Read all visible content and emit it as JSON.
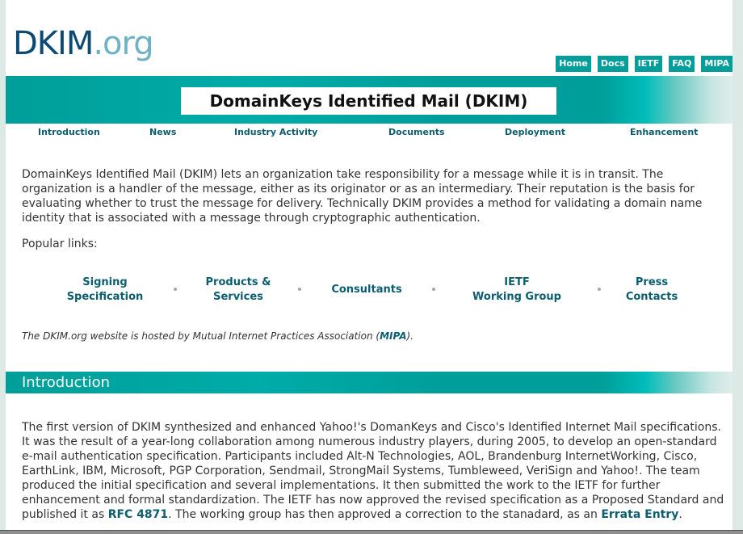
{
  "site": {
    "logo_primary": "DKIM",
    "logo_secondary": ".org"
  },
  "top_nav": [
    {
      "label": "Home"
    },
    {
      "label": "Docs"
    },
    {
      "label": "IETF"
    },
    {
      "label": "FAQ"
    },
    {
      "label": "MIPA"
    }
  ],
  "banner": {
    "title": "DomainKeys Identified Mail (DKIM)"
  },
  "section_nav": [
    {
      "label": "Introduction"
    },
    {
      "label": "News"
    },
    {
      "label": "Industry Activity"
    },
    {
      "label": "Documents"
    },
    {
      "label": "Deployment"
    },
    {
      "label": "Enhancement"
    }
  ],
  "intro": {
    "paragraph": "DomainKeys Identified Mail (DKIM) lets an organization take responsibility for a message while it is in transit.  The organization is a handler of the message, either as its originator or as an intermediary. Their reputation is the basis for evaluating whether to trust the message for delivery. Technically DKIM provides a method for validating a domain name identity that is associated with a message through cryptographic authentication.",
    "popular_label": "Popular links:"
  },
  "popular_links": [
    {
      "line1": "Signing",
      "line2": "Specification"
    },
    {
      "line1": "Products &",
      "line2": "Services"
    },
    {
      "line1": "Consultants",
      "line2": ""
    },
    {
      "line1": "IETF",
      "line2": "Working Group"
    },
    {
      "line1": "Press",
      "line2": "Contacts"
    }
  ],
  "hosted_note": {
    "before": "The DKIM.org website is hosted by Mutual Internet Practices Association (",
    "link": "MIPA",
    "after": ")."
  },
  "introduction_section": {
    "title": "Introduction",
    "text_part1": "The first version of DKIM synthesized and enhanced Yahoo!'s DomanKeys and Cisco's Identified Internet Mail specifications. It was the result of a year-long collaboration among numerous industry players, during 2005, to develop an open-standard e-mail authentication specification. Participants included Alt-N Technologies, AOL, Brandenburg InternetWorking, Cisco, EarthLink, IBM, Microsoft, PGP Corporation, Sendmail, StrongMail Systems, Tumbleweed, VeriSign and Yahoo!. The team produced the initial specification and several implementations. It then submitted the work to the IETF for further enhancement and formal standardization. The IETF has now approved the revised specification as a Proposed Standard and published it as ",
    "link1": "RFC 4871",
    "text_part2": ". The working group has then approved a correction to the stanadard, as an ",
    "link2": "Errata Entry",
    "text_part3": "."
  },
  "colors": {
    "teal": "#009e9a",
    "link": "#0b5e70",
    "logo_dark": "#0d4a73",
    "logo_light": "#6fb2c6",
    "sidebar": "#dde9e4"
  }
}
